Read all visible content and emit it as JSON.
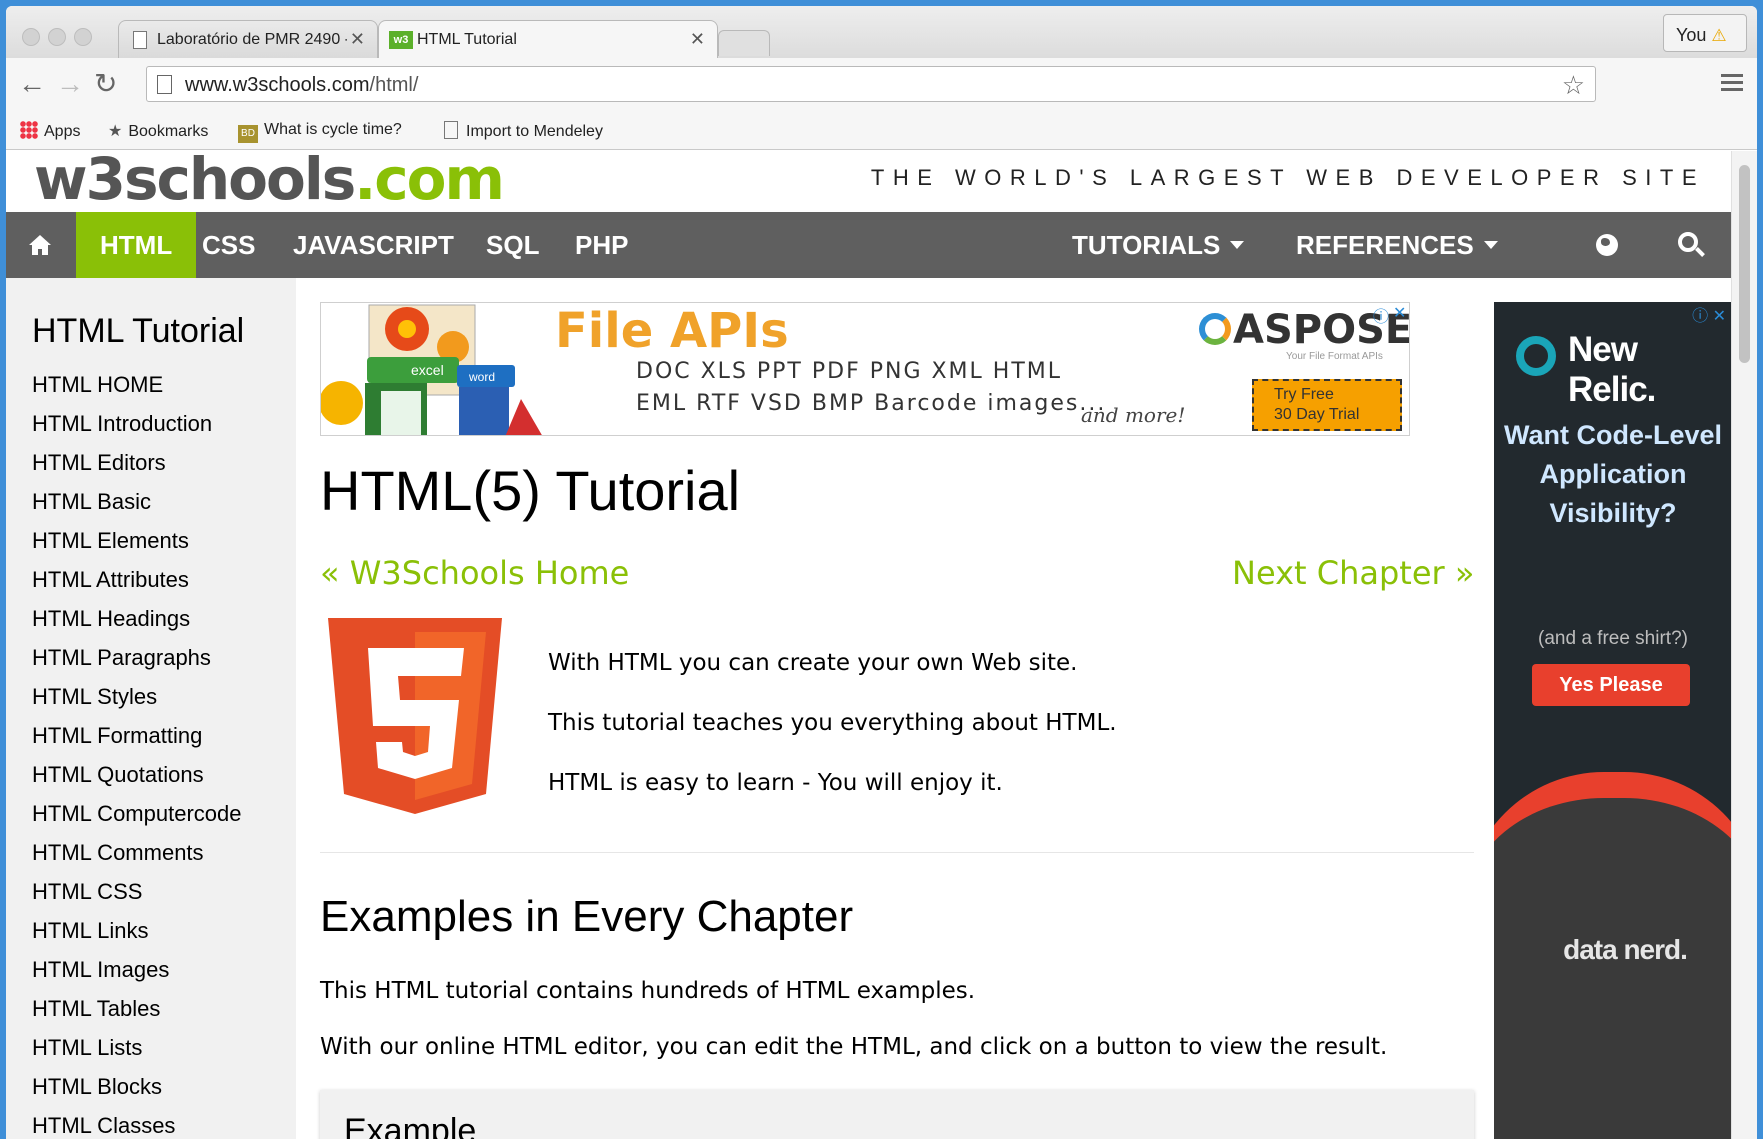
{
  "browser": {
    "tabs": [
      {
        "title": "Laboratório de PMR 2490 - ",
        "active": false
      },
      {
        "title": "HTML Tutorial",
        "active": true
      }
    ],
    "profile_label": "You",
    "url_host": "www.w3schools.com",
    "url_path": "/html/",
    "bookmarks": [
      {
        "label": "Apps",
        "icon": "apps-grid-icon"
      },
      {
        "label": "Bookmarks",
        "icon": "star-icon"
      },
      {
        "label": "What is cycle time?",
        "icon": "bd-favicon"
      },
      {
        "label": "Import to Mendeley",
        "icon": "document-icon"
      }
    ]
  },
  "site": {
    "logo_main": "w3schools",
    "logo_tld": ".com",
    "tagline": "THE WORLD'S LARGEST WEB DEVELOPER SITE",
    "accent_color": "#8ac007",
    "nav": {
      "items": [
        "HTML",
        "CSS",
        "JAVASCRIPT",
        "SQL",
        "PHP"
      ],
      "tutorials": "TUTORIALS",
      "references": "REFERENCES"
    }
  },
  "sidebar": {
    "title": "HTML Tutorial",
    "items": [
      "HTML HOME",
      "HTML Introduction",
      "HTML Editors",
      "HTML Basic",
      "HTML Elements",
      "HTML Attributes",
      "HTML Headings",
      "HTML Paragraphs",
      "HTML Styles",
      "HTML Formatting",
      "HTML Quotations",
      "HTML Computercode",
      "HTML Comments",
      "HTML CSS",
      "HTML Links",
      "HTML Images",
      "HTML Tables",
      "HTML Lists",
      "HTML Blocks",
      "HTML Classes"
    ]
  },
  "ad_banner": {
    "headline": "File APIs",
    "formats_line1": "DOC XLS PPT PDF PNG XML HTML",
    "formats_line2": "EML RTF VSD BMP Barcode images...",
    "and_more": "and more!",
    "brand": "ASPOSE",
    "brand_sub": "Your File Format APIs",
    "cta_line1": "Try Free",
    "cta_line2": "30 Day Trial",
    "excel_label": "excel",
    "word_label": "word"
  },
  "main": {
    "title": "HTML(5) Tutorial",
    "prev_link": "« W3Schools Home",
    "next_link": "Next Chapter »",
    "intro": [
      "With HTML you can create your own Web site.",
      "This tutorial teaches you everything about HTML.",
      "HTML is easy to learn - You will enjoy it."
    ],
    "examples_heading": "Examples in Every Chapter",
    "examples_p1": "This HTML tutorial contains hundreds of HTML examples.",
    "examples_p2": "With our online HTML editor, you can edit the HTML, and click on a button to view the result.",
    "example_box_title": "Example"
  },
  "side_ad": {
    "brand": "New Relic.",
    "headline": "Want Code-Level Application Visibility?",
    "subtext": "(and a free shirt?)",
    "button": "Yes Please",
    "shirt_text": "data nerd."
  }
}
